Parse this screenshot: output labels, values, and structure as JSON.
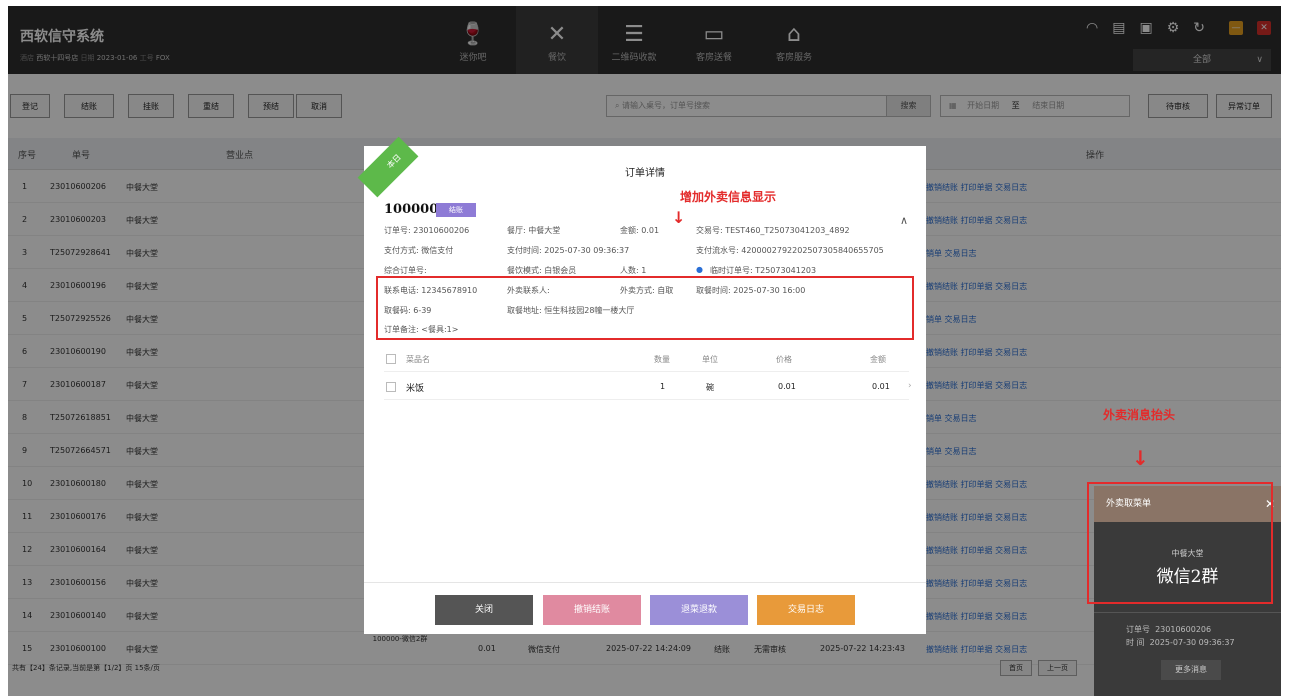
{
  "header": {
    "brand": "西软信守系统",
    "store_label": "酒店",
    "store": "西软十四号店",
    "date_label": "日期",
    "date": "2023-01-06",
    "staff_label": "工号",
    "staff": "FOX",
    "nav": [
      {
        "label": "迷你吧",
        "icon": "bottle-icon"
      },
      {
        "label": "餐饮",
        "icon": "cutlery-icon"
      },
      {
        "label": "二维码收款",
        "icon": "qrcode-icon"
      },
      {
        "label": "客房送餐",
        "icon": "bed-icon"
      },
      {
        "label": "客房服务",
        "icon": "house-icon"
      }
    ],
    "select_value": "全部"
  },
  "toolbar": {
    "buttons": [
      "登记",
      "结账",
      "挂账",
      "重结",
      "预结",
      "取消"
    ],
    "search_placeholder": "请输入桌号，订单号搜索",
    "search_button": "搜索",
    "date_start": "开始日期",
    "date_sep": "至",
    "date_end": "结束日期",
    "pending": "待审核",
    "abnormal": "异常订单"
  },
  "grid": {
    "headers": {
      "seq": "序号",
      "no": "单号",
      "outlet": "营业点",
      "ops": "操作"
    },
    "rows": [
      {
        "seq": "1",
        "no": "23010600206",
        "outlet": "中餐大堂",
        "ops": "撤销结账  打印单据  交易日志"
      },
      {
        "seq": "2",
        "no": "23010600203",
        "outlet": "中餐大堂",
        "ops": "撤销结账  打印单据  交易日志"
      },
      {
        "seq": "3",
        "no": "T25072928641",
        "outlet": "中餐大堂",
        "ops": "销单  交易日志"
      },
      {
        "seq": "4",
        "no": "23010600196",
        "outlet": "中餐大堂",
        "ops": "撤销结账  打印单据  交易日志"
      },
      {
        "seq": "5",
        "no": "T25072925526",
        "outlet": "中餐大堂",
        "ops": "销单  交易日志"
      },
      {
        "seq": "6",
        "no": "23010600190",
        "outlet": "中餐大堂",
        "ops": "撤销结账  打印单据  交易日志"
      },
      {
        "seq": "7",
        "no": "23010600187",
        "outlet": "中餐大堂",
        "ops": "撤销结账  打印单据  交易日志"
      },
      {
        "seq": "8",
        "no": "T25072618851",
        "outlet": "中餐大堂",
        "ops": "销单  交易日志"
      },
      {
        "seq": "9",
        "no": "T25072664571",
        "outlet": "中餐大堂",
        "ops": "销单  交易日志"
      },
      {
        "seq": "10",
        "no": "23010600180",
        "outlet": "中餐大堂",
        "ops": "撤销结账  打印单据  交易日志"
      },
      {
        "seq": "11",
        "no": "23010600176",
        "outlet": "中餐大堂",
        "ops": "撤销结账  打印单据  交易日志"
      },
      {
        "seq": "12",
        "no": "23010600164",
        "outlet": "中餐大堂",
        "ops": "撤销结账  打印单据  交易日志"
      },
      {
        "seq": "13",
        "no": "23010600156",
        "outlet": "中餐大堂",
        "ops": "撤销结账  打印单据  交易日志"
      },
      {
        "seq": "14",
        "no": "23010600140",
        "outlet": "中餐大堂",
        "ops": "撤销结账  打印单据  交易日志"
      }
    ],
    "last_row": {
      "seq": "15",
      "no": "23010600100",
      "outlet": "中餐大堂",
      "table": "100000-微信2群",
      "amount": "0.01",
      "pay": "微信支付",
      "time": "2025-07-22 14:24:09",
      "status": "结账",
      "audit": "无需审核",
      "time2": "2025-07-22 14:23:43",
      "ops": "撤销结账  打印单据  交易日志"
    }
  },
  "footer": {
    "summary": "共有【24】条记录,当前是第【1/2】页  15条/页",
    "first": "首页",
    "prev": "上一页"
  },
  "modal": {
    "ribbon": "本日",
    "title": "订单详情",
    "order_no": "100000",
    "status_tag": "结账",
    "info_rows": [
      [
        "订单号: 23010600206",
        "餐厅: 中餐大堂",
        "金额: 0.01",
        "交易号: TEST460_T25073041203_4892"
      ],
      [
        "支付方式: 微信支付",
        "支付时间: 2025-07-30 09:36:37",
        "",
        "支付流水号: 4200002792202507305840655705"
      ],
      [
        "综合订单号:",
        "餐饮模式: 白银会员",
        "人数: 1",
        "临时订单号: T25073041203"
      ]
    ],
    "delivery": {
      "phone": "联系电话: 12345678910",
      "contact": "外卖联系人:",
      "method": "外卖方式: 自取",
      "pickup_time": "取餐时间:  2025-07-30 16:00",
      "code": "取餐码: 6-39",
      "address": "取餐地址:  恒生科技园28幢一楼大厅",
      "remark": "订单备注: <餐具:1>"
    },
    "annotation": "增加外卖信息显示",
    "items_header": {
      "name": "菜品名",
      "qty": "数量",
      "unit": "单位",
      "price": "价格",
      "amount": "金额"
    },
    "items": [
      {
        "name": "米饭",
        "qty": "1",
        "unit": "碗",
        "price": "0.01",
        "amount": "0.01"
      }
    ],
    "buttons": {
      "close": "关闭",
      "cancel": "撤销结账",
      "refund": "退菜退款",
      "log": "交易日志"
    }
  },
  "popup": {
    "annotation": "外卖消息抬头",
    "title": "外卖取菜单",
    "outlet": "中餐大堂",
    "group": "微信2群",
    "order_label": "订单号",
    "order_no": "23010600206",
    "time_label": "时  间",
    "time": "2025-07-30 09:36:37",
    "more": "更多消息"
  },
  "colors": {
    "accent": "#e32b2b",
    "purple": "#8e7bd6",
    "pink": "#e08aa0",
    "lavender": "#9b8fd8",
    "orange": "#e89a3a",
    "close": "#555555",
    "green": "#5db94a"
  }
}
